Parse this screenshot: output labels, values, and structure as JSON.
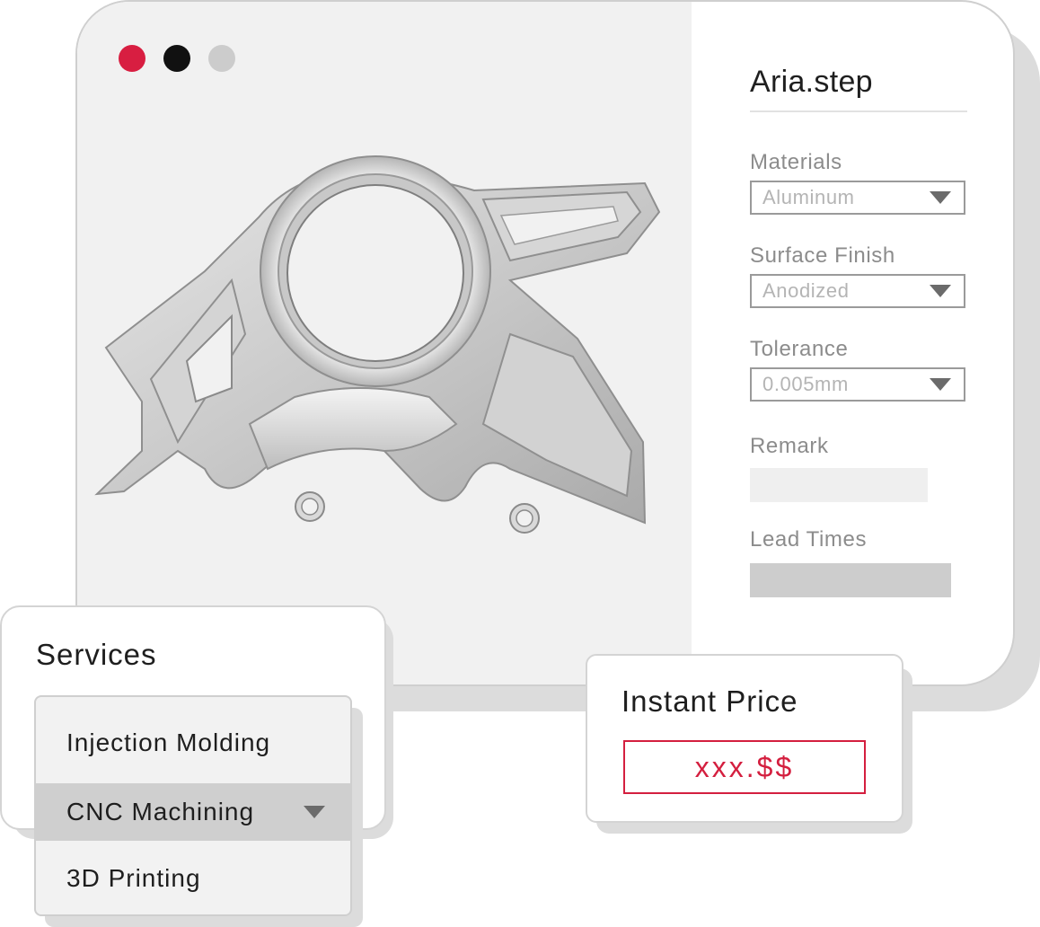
{
  "window": {
    "traffic_lights": [
      {
        "name": "close",
        "color": "#d81e41"
      },
      {
        "name": "minimize",
        "color": "#111111"
      },
      {
        "name": "maximize",
        "color": "#cccccc"
      }
    ],
    "part_icon": "aluminum-bracket-part"
  },
  "sidebar": {
    "file_name": "Aria.step",
    "materials": {
      "label": "Materials",
      "value": "Aluminum"
    },
    "surface_finish": {
      "label": "Surface Finish",
      "value": "Anodized"
    },
    "tolerance": {
      "label": "Tolerance",
      "value": "0.005mm"
    },
    "remark": {
      "label": "Remark"
    },
    "lead_times": {
      "label": "Lead Times"
    }
  },
  "services": {
    "title": "Services",
    "options": [
      "Injection Molding",
      "CNC Machining",
      "3D Printing"
    ],
    "selected": "CNC Machining"
  },
  "price": {
    "title": "Instant Price",
    "value": "xxx.$$",
    "accent_color": "#d41f3f"
  }
}
